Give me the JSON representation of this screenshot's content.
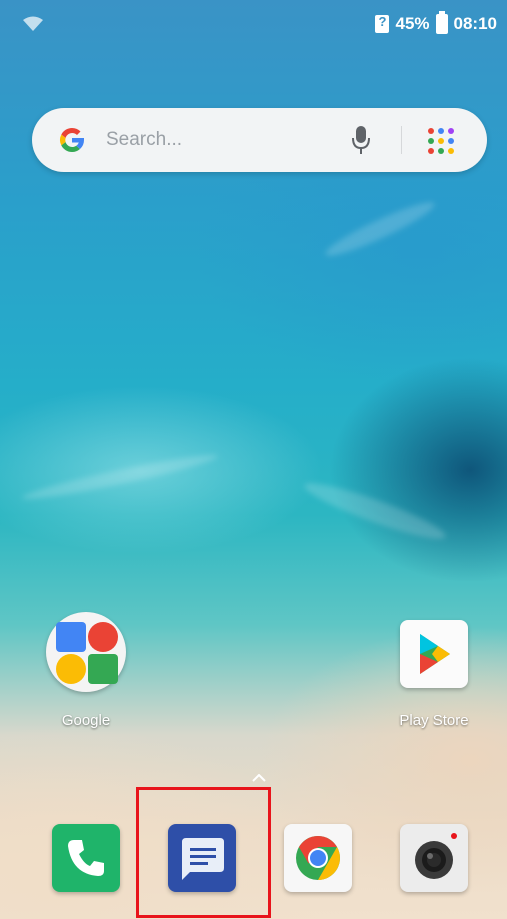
{
  "status_bar": {
    "battery_percent": "45%",
    "time": "08:10",
    "icons": [
      "wifi-icon",
      "sim-icon",
      "battery-icon"
    ]
  },
  "search": {
    "placeholder": "Search...",
    "icons": [
      "google-g-icon",
      "mic-icon",
      "apps-grid-icon"
    ]
  },
  "home_apps": [
    {
      "label": "Google",
      "icon": "google-folder-icon"
    },
    {
      "label": "Play Store",
      "icon": "play-store-icon"
    }
  ],
  "dock": [
    {
      "name": "Phone",
      "icon": "phone-icon"
    },
    {
      "name": "Messages",
      "icon": "messages-icon"
    },
    {
      "name": "Chrome",
      "icon": "chrome-icon"
    },
    {
      "name": "Camera",
      "icon": "camera-icon"
    }
  ],
  "colors": {
    "highlight": "#e8141b",
    "phone": "#1fb46a",
    "messages": "#2e4fa8",
    "google_blue": "#4285f4",
    "google_red": "#ea4335",
    "google_yellow": "#fbbc05",
    "google_green": "#34a853"
  }
}
